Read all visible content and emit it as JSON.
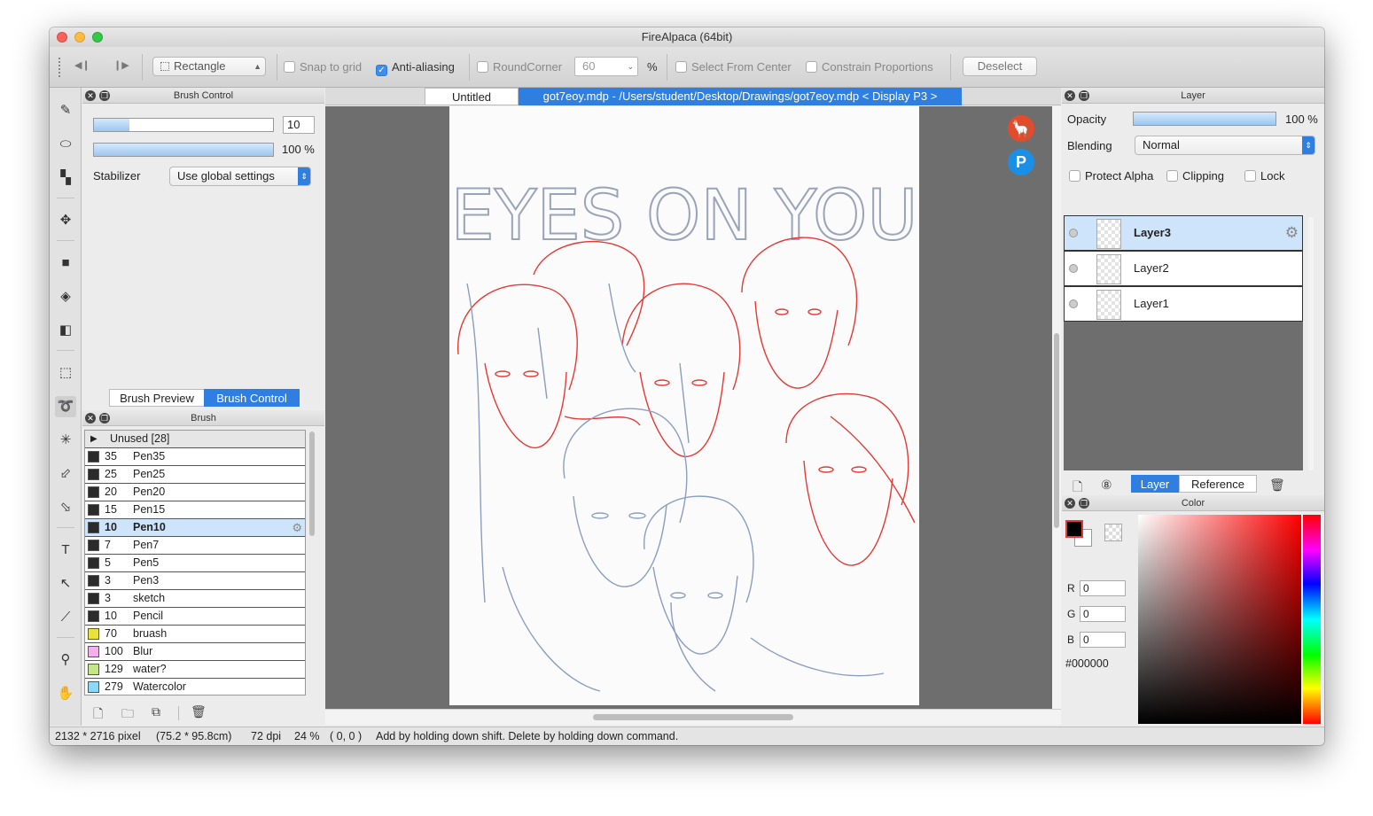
{
  "window": {
    "title": "FireAlpaca (64bit)"
  },
  "toolbar": {
    "selection_shape": "Rectangle",
    "snap_to_grid": "Snap to grid",
    "anti_aliasing": "Anti-aliasing",
    "round_corner": "RoundCorner",
    "round_corner_value": "60",
    "percent": "%",
    "select_from_center": "Select From Center",
    "constrain_proportions": "Constrain Proportions",
    "deselect": "Deselect"
  },
  "brush_control": {
    "title": "Brush Control",
    "size_value": "10",
    "opacity_value": "100 %",
    "stabilizer_label": "Stabilizer",
    "stabilizer_value": "Use global settings",
    "tab_preview": "Brush Preview",
    "tab_control": "Brush Control"
  },
  "brush_panel": {
    "title": "Brush",
    "group": "Unused [28]",
    "items": [
      {
        "size": "35",
        "name": "Pen35",
        "color": "#2b2b2b"
      },
      {
        "size": "25",
        "name": "Pen25",
        "color": "#2b2b2b"
      },
      {
        "size": "20",
        "name": "Pen20",
        "color": "#2b2b2b"
      },
      {
        "size": "15",
        "name": "Pen15",
        "color": "#2b2b2b"
      },
      {
        "size": "10",
        "name": "Pen10",
        "color": "#2b2b2b"
      },
      {
        "size": "7",
        "name": "Pen7",
        "color": "#2b2b2b"
      },
      {
        "size": "5",
        "name": "Pen5",
        "color": "#2b2b2b"
      },
      {
        "size": "3",
        "name": "Pen3",
        "color": "#2b2b2b"
      },
      {
        "size": "3",
        "name": "sketch",
        "color": "#2b2b2b"
      },
      {
        "size": "10",
        "name": "Pencil",
        "color": "#2b2b2b"
      },
      {
        "size": "70",
        "name": "bruash",
        "color": "#e8e23a"
      },
      {
        "size": "100",
        "name": "Blur",
        "color": "#f3b0ec"
      },
      {
        "size": "129",
        "name": "water?",
        "color": "#c4e58a"
      },
      {
        "size": "279",
        "name": "Watercolor",
        "color": "#8fd8f5"
      }
    ]
  },
  "document": {
    "tab_untitled": "Untitled",
    "tab_active": "got7eoy.mdp - /Users/student/Desktop/Drawings/got7eoy.mdp < Display P3 >",
    "artwork_text": "EYES ON YOU"
  },
  "layer_panel": {
    "title": "Layer",
    "opacity_label": "Opacity",
    "opacity_value": "100 %",
    "blending_label": "Blending",
    "blending_value": "Normal",
    "protect_alpha": "Protect Alpha",
    "clipping": "Clipping",
    "lock": "Lock",
    "layers": [
      "Layer3",
      "Layer2",
      "Layer1"
    ],
    "tab_layer": "Layer",
    "tab_reference": "Reference"
  },
  "color_panel": {
    "title": "Color",
    "r_label": "R",
    "r_value": "0",
    "g_label": "G",
    "g_value": "0",
    "b_label": "B",
    "b_value": "0",
    "hex": "#000000"
  },
  "statusbar": {
    "pixel_size": "2132 * 2716 pixel",
    "cm_size": "(75.2 * 95.8cm)",
    "dpi": "72 dpi",
    "zoom": "24 %",
    "coords": "( 0, 0 )",
    "hint": "Add by holding down shift. Delete by holding down command."
  }
}
